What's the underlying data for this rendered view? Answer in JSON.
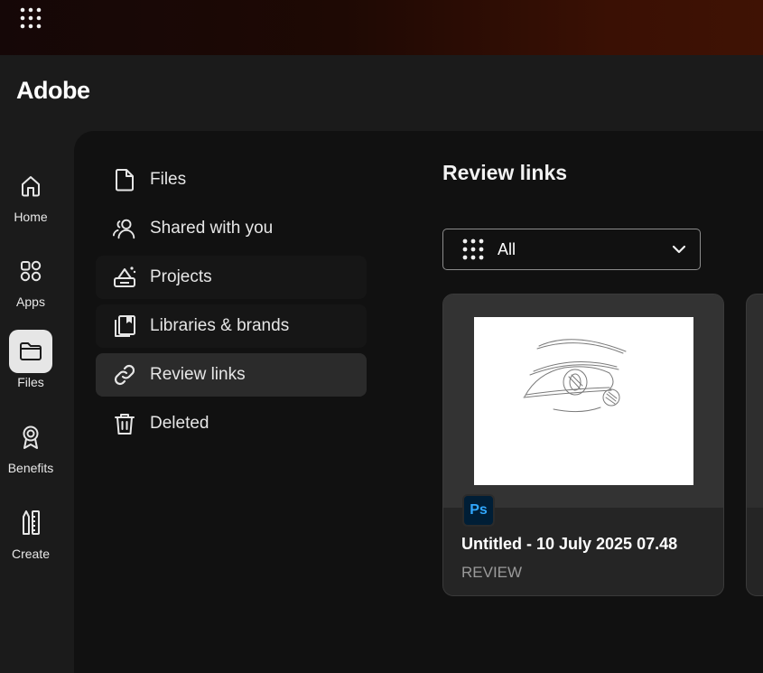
{
  "header": {
    "logo": "Adobe"
  },
  "rail": {
    "items": [
      {
        "label": "Home",
        "icon": "home-icon",
        "active": false
      },
      {
        "label": "Apps",
        "icon": "apps-icon",
        "active": false
      },
      {
        "label": "Files",
        "icon": "folder-icon",
        "active": true
      },
      {
        "label": "Benefits",
        "icon": "award-icon",
        "active": false
      },
      {
        "label": "Create",
        "icon": "pencil-ruler-icon",
        "active": false
      }
    ]
  },
  "sidebar": {
    "items": [
      {
        "label": "Files",
        "icon": "file-icon"
      },
      {
        "label": "Shared with you",
        "icon": "users-icon"
      },
      {
        "label": "Projects",
        "icon": "projects-icon"
      },
      {
        "label": "Libraries & brands",
        "icon": "libraries-icon"
      },
      {
        "label": "Review links",
        "icon": "link-icon",
        "active": true
      },
      {
        "label": "Deleted",
        "icon": "trash-icon"
      }
    ]
  },
  "main": {
    "title": "Review links",
    "filter": {
      "selected": "All"
    },
    "cards": [
      {
        "badge": "Ps",
        "title": "Untitled - 10 July 2025 07.48",
        "subtitle": "REVIEW"
      }
    ]
  },
  "colors": {
    "ps_badge_bg": "#001e36",
    "ps_badge_fg": "#31a8ff",
    "active_nav": "#2b2b2b"
  }
}
